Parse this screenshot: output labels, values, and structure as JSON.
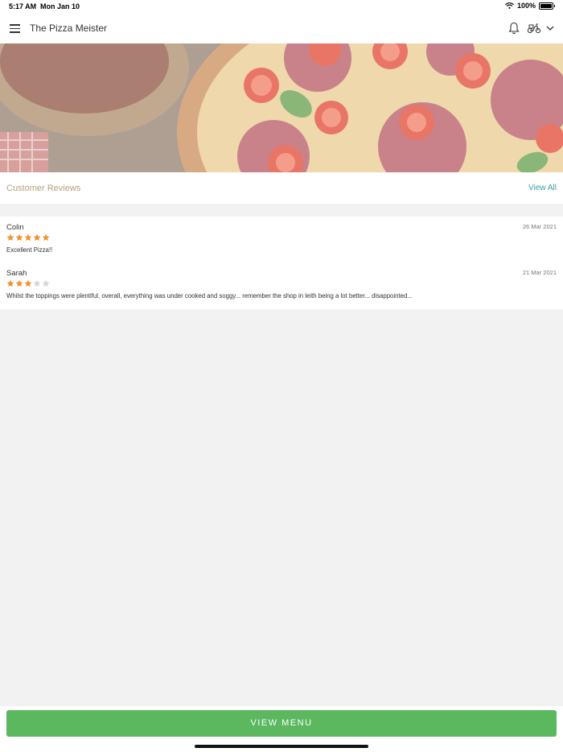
{
  "status_bar": {
    "time": "5:17 AM",
    "date": "Mon Jan 10",
    "battery": "100%"
  },
  "header": {
    "title": "The Pizza Meister"
  },
  "reviews": {
    "title": "Customer Reviews",
    "view_all_label": "View All",
    "items": [
      {
        "name": "Colin",
        "date": "26 Mar 2021",
        "rating": 5,
        "max_rating": 5,
        "text": "Excellent Pizza!!"
      },
      {
        "name": "Sarah",
        "date": "21 Mar 2021",
        "rating": 3,
        "max_rating": 5,
        "text": "Whilst the toppings were plentiful, overall, everything was under cooked and soggy... remember the shop in leith being a lot better... disappointed..."
      }
    ]
  },
  "footer": {
    "view_menu_label": "VIEW MENU"
  },
  "colors": {
    "accent_green": "#5cb85f",
    "star_filled": "#f0922e",
    "star_empty": "#d6d6d6",
    "link": "#3aa0a8",
    "section_title": "#b8a07c"
  },
  "icons": [
    "menu-icon",
    "bell-icon",
    "scooter-icon",
    "chevron-down-icon",
    "wifi-icon",
    "battery-icon",
    "star-icon"
  ]
}
